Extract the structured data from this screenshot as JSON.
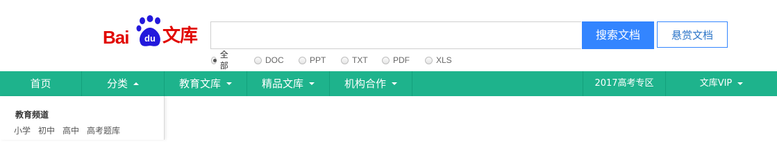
{
  "logo": {
    "text_bai": "Bai",
    "text_du": "du",
    "text_wenku": "文库"
  },
  "search": {
    "query": "",
    "button": "搜索文档",
    "reward_button": "悬赏文档"
  },
  "filters": [
    {
      "label": "全部",
      "selected": true
    },
    {
      "label": "DOC",
      "selected": false
    },
    {
      "label": "PPT",
      "selected": false
    },
    {
      "label": "TXT",
      "selected": false
    },
    {
      "label": "PDF",
      "selected": false
    },
    {
      "label": "XLS",
      "selected": false
    }
  ],
  "nav": {
    "items": [
      {
        "label": "首页"
      },
      {
        "label": "分类"
      },
      {
        "label": "教育文库"
      },
      {
        "label": "精品文库"
      },
      {
        "label": "机构合作"
      }
    ],
    "right_items": [
      {
        "label": "2017高考专区"
      },
      {
        "label": "文库VIP"
      }
    ]
  },
  "dropdown": {
    "title": "教育频道",
    "links": [
      "小学",
      "初中",
      "高中",
      "高考题库"
    ]
  },
  "colors": {
    "brand_red": "#e10601",
    "nav_green": "#1eb38c",
    "search_blue": "#3385ff"
  }
}
